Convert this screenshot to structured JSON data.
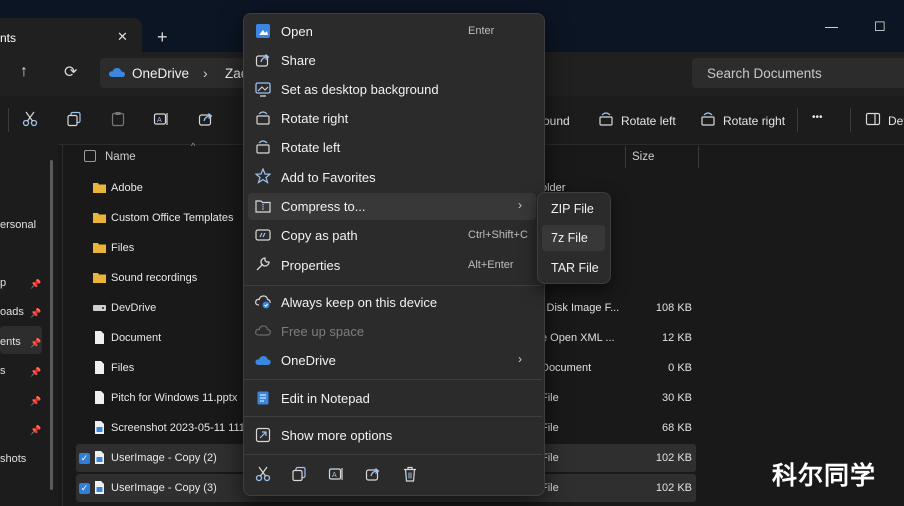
{
  "window": {
    "tab_title": "nts",
    "tab_close": "✕",
    "tab_add": "+",
    "controls": [
      "—",
      "☐"
    ]
  },
  "nav": {
    "up": "↑",
    "refresh": "⟳"
  },
  "address": {
    "segments": [
      "OneDrive",
      "Zac"
    ],
    "separator": "›"
  },
  "search": {
    "placeholder": "Search Documents"
  },
  "toolbar": {
    "icons": [
      "cut-icon",
      "copy-icon",
      "paste-icon",
      "rename-icon",
      "share-icon"
    ],
    "partial_label": "ound",
    "rotate_left": "Rotate left",
    "rotate_right": "Rotate right",
    "more": "•••",
    "details": "Det"
  },
  "sidebar": {
    "items": [
      {
        "label": "ersonal",
        "pinned": false
      },
      {
        "label": "p",
        "pinned": true
      },
      {
        "label": "oads",
        "pinned": true
      },
      {
        "label": "ents",
        "pinned": true,
        "selected": true
      },
      {
        "label": "s",
        "pinned": true
      },
      {
        "label": "",
        "pinned": true
      },
      {
        "label": "",
        "pinned": true
      },
      {
        "label": "shots",
        "pinned": false
      }
    ],
    "pin_glyph": "📌"
  },
  "list": {
    "headers": {
      "name": "Name",
      "size": "Size",
      "sort_indicator": "^"
    },
    "rows": [
      {
        "name": "Adobe",
        "type": "older",
        "size": "",
        "icon": "folder-icon",
        "selected": false
      },
      {
        "name": "Custom Office Templates",
        "type": "",
        "size": "",
        "icon": "folder-icon",
        "selected": false
      },
      {
        "name": "Files",
        "type": "",
        "size": "",
        "icon": "folder-icon",
        "selected": false
      },
      {
        "name": "Sound recordings",
        "type": "",
        "size": "",
        "icon": "folder-icon",
        "selected": false
      },
      {
        "name": "DevDrive",
        "type": "l Disk Image F...",
        "size": "108 KB",
        "icon": "drive-icon",
        "selected": false
      },
      {
        "name": "Document",
        "type": "e Open XML ...",
        "size": "12 KB",
        "icon": "document-icon",
        "selected": false
      },
      {
        "name": "Files",
        "type": "Document",
        "size": "0 KB",
        "icon": "document-icon",
        "selected": false
      },
      {
        "name": "Pitch for Windows 11.pptx",
        "type": "File",
        "size": "30 KB",
        "icon": "document-icon",
        "selected": false
      },
      {
        "name": "Screenshot 2023-05-11 111",
        "type": "File",
        "size": "68 KB",
        "icon": "image-file-icon",
        "selected": false
      },
      {
        "name": "UserImage - Copy (2)",
        "type": "File",
        "size": "102 KB",
        "icon": "image-file-icon",
        "selected": true
      },
      {
        "name": "UserImage - Copy (3)",
        "type": "File",
        "size": "102 KB",
        "icon": "image-file-icon",
        "selected": true
      }
    ],
    "checkmark": "✓"
  },
  "context_menu": {
    "items": [
      {
        "label": "Open",
        "shortcut": "Enter",
        "icon": "open-icon"
      },
      {
        "label": "Share",
        "shortcut": "",
        "icon": "share-icon"
      },
      {
        "label": "Set as desktop background",
        "shortcut": "",
        "icon": "desktop-background-icon"
      },
      {
        "label": "Rotate right",
        "shortcut": "",
        "icon": "rotate-right-icon"
      },
      {
        "label": "Rotate left",
        "shortcut": "",
        "icon": "rotate-left-icon"
      },
      {
        "label": "Add to Favorites",
        "shortcut": "",
        "icon": "star-icon"
      },
      {
        "label": "Compress to...",
        "shortcut": "",
        "icon": "zip-icon",
        "submenu": true,
        "highlighted": true
      },
      {
        "label": "Copy as path",
        "shortcut": "Ctrl+Shift+C",
        "icon": "copy-path-icon"
      },
      {
        "label": "Properties",
        "shortcut": "Alt+Enter",
        "icon": "wrench-icon"
      },
      {
        "label": "Always keep on this device",
        "shortcut": "",
        "icon": "cloud-sync-icon"
      },
      {
        "label": "Free up space",
        "shortcut": "",
        "icon": "cloud-outline-icon",
        "disabled": true
      },
      {
        "label": "OneDrive",
        "shortcut": "",
        "icon": "onedrive-icon",
        "submenu": true
      },
      {
        "label": "Edit in Notepad",
        "shortcut": "",
        "icon": "notepad-icon"
      },
      {
        "label": "Show more options",
        "shortcut": "",
        "icon": "more-options-icon"
      }
    ],
    "submenu_arrow": "›",
    "bottom_bar": [
      "cut-icon",
      "copy-icon",
      "rename-icon",
      "share-icon",
      "delete-icon"
    ]
  },
  "compress_submenu": {
    "items": [
      "ZIP File",
      "7z File",
      "TAR File"
    ],
    "highlighted_index": 1
  },
  "watermark": "科尔同学",
  "colors": {
    "accent": "#2f7fd6",
    "menu_bg": "#2b2b2b",
    "folder": "#e8b43a",
    "onedrive": "#3a86e0"
  }
}
